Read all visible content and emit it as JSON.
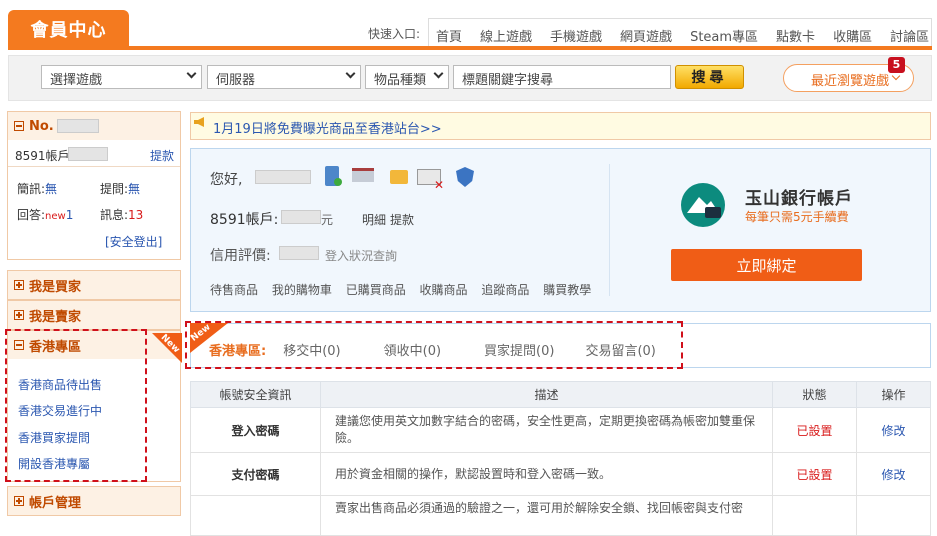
{
  "header": {
    "member_center": "會員中心",
    "quick_label": "快速入口:",
    "nav": [
      "首頁",
      "線上遊戲",
      "手機遊戲",
      "網頁遊戲",
      "Steam專區",
      "點數卡",
      "收購區",
      "討論區"
    ]
  },
  "search": {
    "game_select": "選擇遊戲",
    "server_select": "伺服器",
    "item_type_select": "物品種類",
    "keyword_placeholder": "標題關鍵字搜尋",
    "search_button": "搜尋",
    "recent_button": "最近瀏覽遊戲",
    "recent_count": "5"
  },
  "sidebar": {
    "no_label": "No.",
    "account_label": "8591帳戶:",
    "withdraw": "提款",
    "brief_label": "簡訊:",
    "brief_value": "無",
    "question_label": "提問:",
    "question_value": "無",
    "reply_label": "回答:",
    "reply_new": "new",
    "reply_value": "1",
    "message_label": "訊息:",
    "message_value": "13",
    "logout": "[安全登出]",
    "buyer": "我是買家",
    "seller": "我是賣家",
    "hk_zone": "香港專區",
    "new_tag": "New",
    "hk_items": [
      "香港商品待出售",
      "香港交易進行中",
      "香港買家提問",
      "開設香港專屬"
    ],
    "account_manage": "帳戶管理"
  },
  "notice": "1月19日將免費曝光商品至香港站台>>",
  "account_card": {
    "greeting": "您好,",
    "balance_label": "8591帳戶:",
    "balance_unit": "元",
    "detail_link": "明細",
    "withdraw_link": "提款",
    "credit_label": "信用評價:",
    "login_status": "登入狀況查詢",
    "links": [
      "待售商品",
      "我的購物車",
      "已購買商品",
      "收購商品",
      "追蹤商品",
      "購買教學"
    ]
  },
  "bank": {
    "name": "玉山銀行帳戶",
    "fee": "每筆只需5元手續費",
    "bind_button": "立即綁定"
  },
  "hk_tabs": {
    "new_tag": "New",
    "title": "香港專區:",
    "tabs": [
      "移交中(0)",
      "領收中(0)",
      "買家提問(0)",
      "交易留言(0)"
    ]
  },
  "security_table": {
    "headers": [
      "帳號安全資訊",
      "描述",
      "狀態",
      "操作"
    ],
    "rows": [
      {
        "name": "登入密碼",
        "desc": "建議您使用英文加數字結合的密碼，安全性更高，定期更換密碼為帳密加雙重保險。",
        "status": "已設置",
        "op": "修改"
      },
      {
        "name": "支付密碼",
        "desc": "用於資金相關的操作，默認設置時和登入密碼一致。",
        "status": "已設置",
        "op": "修改"
      },
      {
        "name": "",
        "desc": "賣家出售商品必須通過的驗證之一，還可用於解除安全鎖、找回帳密與支付密",
        "status": "",
        "op": ""
      }
    ]
  },
  "colors": {
    "orange": "#f47a1f",
    "red": "#d0101b",
    "blue": "#2b57b0"
  }
}
